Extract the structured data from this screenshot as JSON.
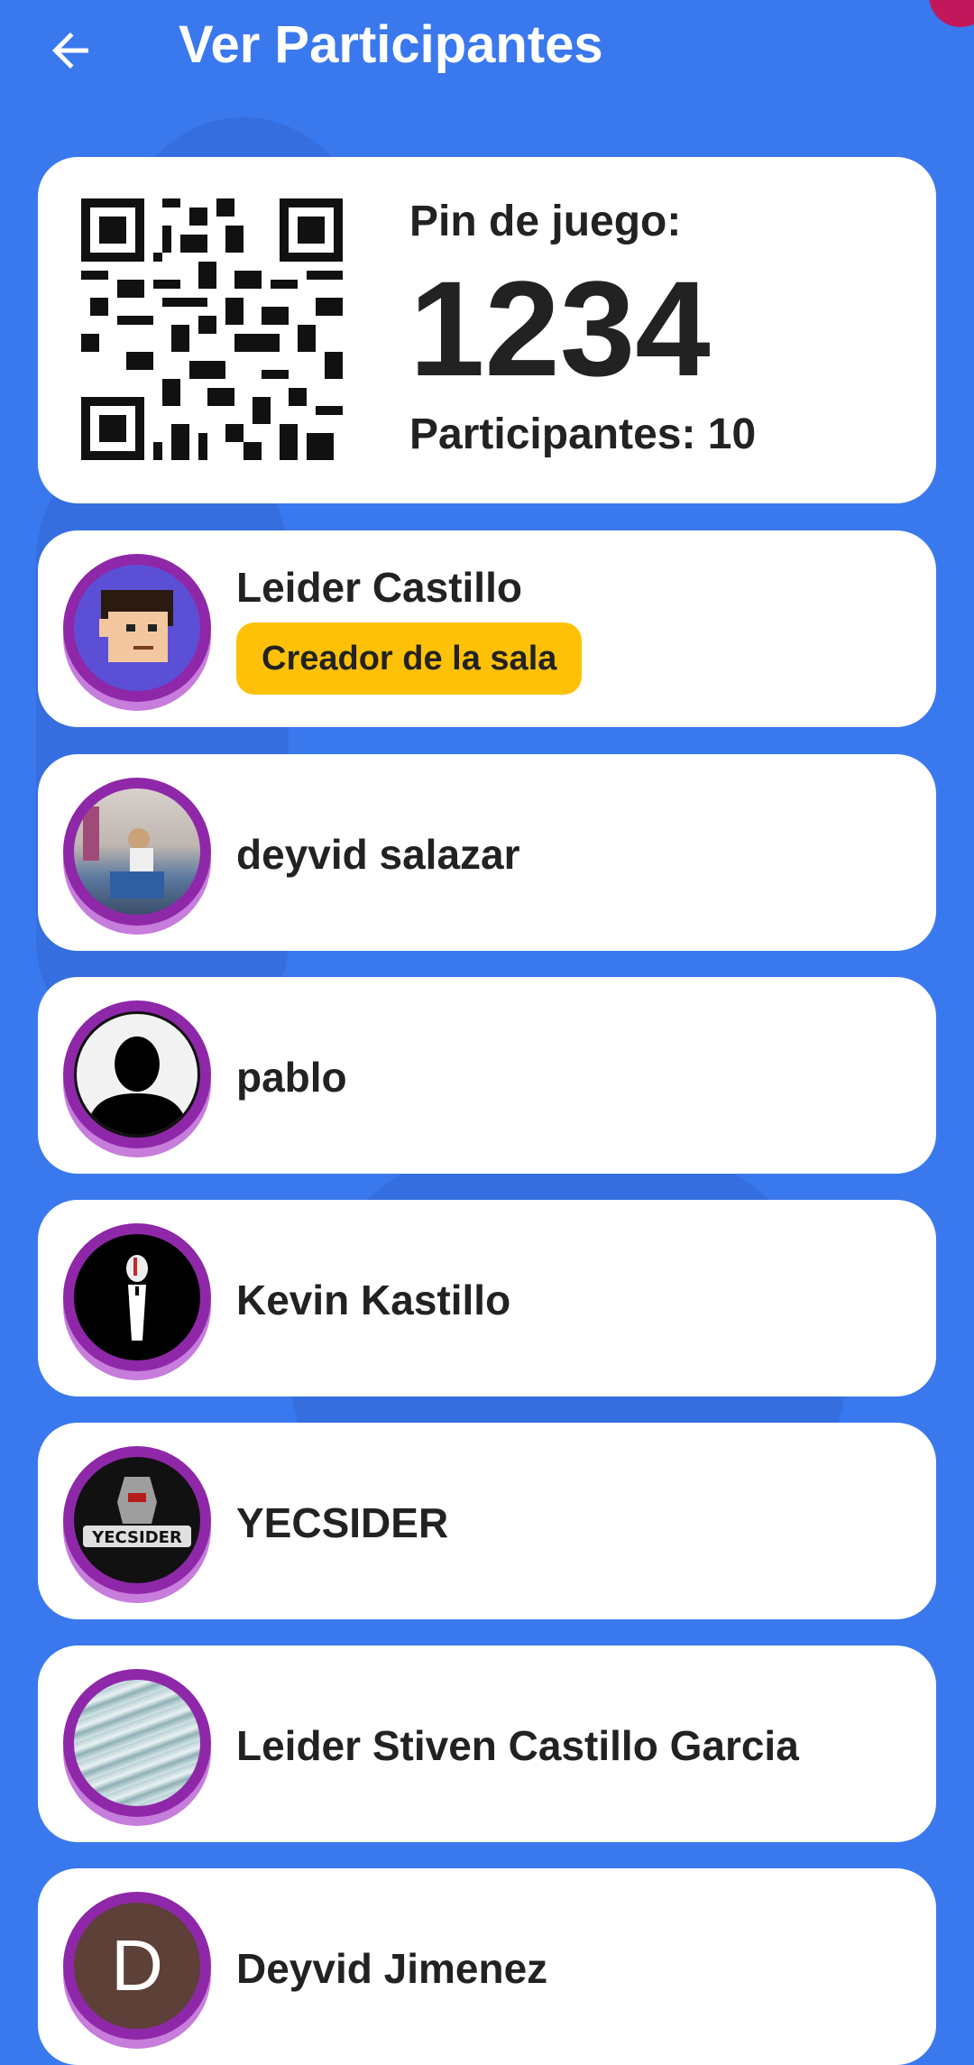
{
  "appbar": {
    "title": "Ver Participantes"
  },
  "game": {
    "pin_label": "Pin de juego:",
    "pin": "1234",
    "participants_text": "Participantes: 10"
  },
  "participants": [
    {
      "name": "Leider Castillo",
      "badge": "Creador de la sala"
    },
    {
      "name": "deyvid salazar"
    },
    {
      "name": "pablo"
    },
    {
      "name": "Kevin Kastillo"
    },
    {
      "name": "YECSIDER"
    },
    {
      "name": "Leider Stiven Castillo Garcia"
    },
    {
      "name": "Deyvid Jimenez",
      "initial": "D"
    }
  ],
  "colors": {
    "background": "#3a78ee",
    "accent_ring": "#8e28a8",
    "badge": "#ffc107"
  }
}
